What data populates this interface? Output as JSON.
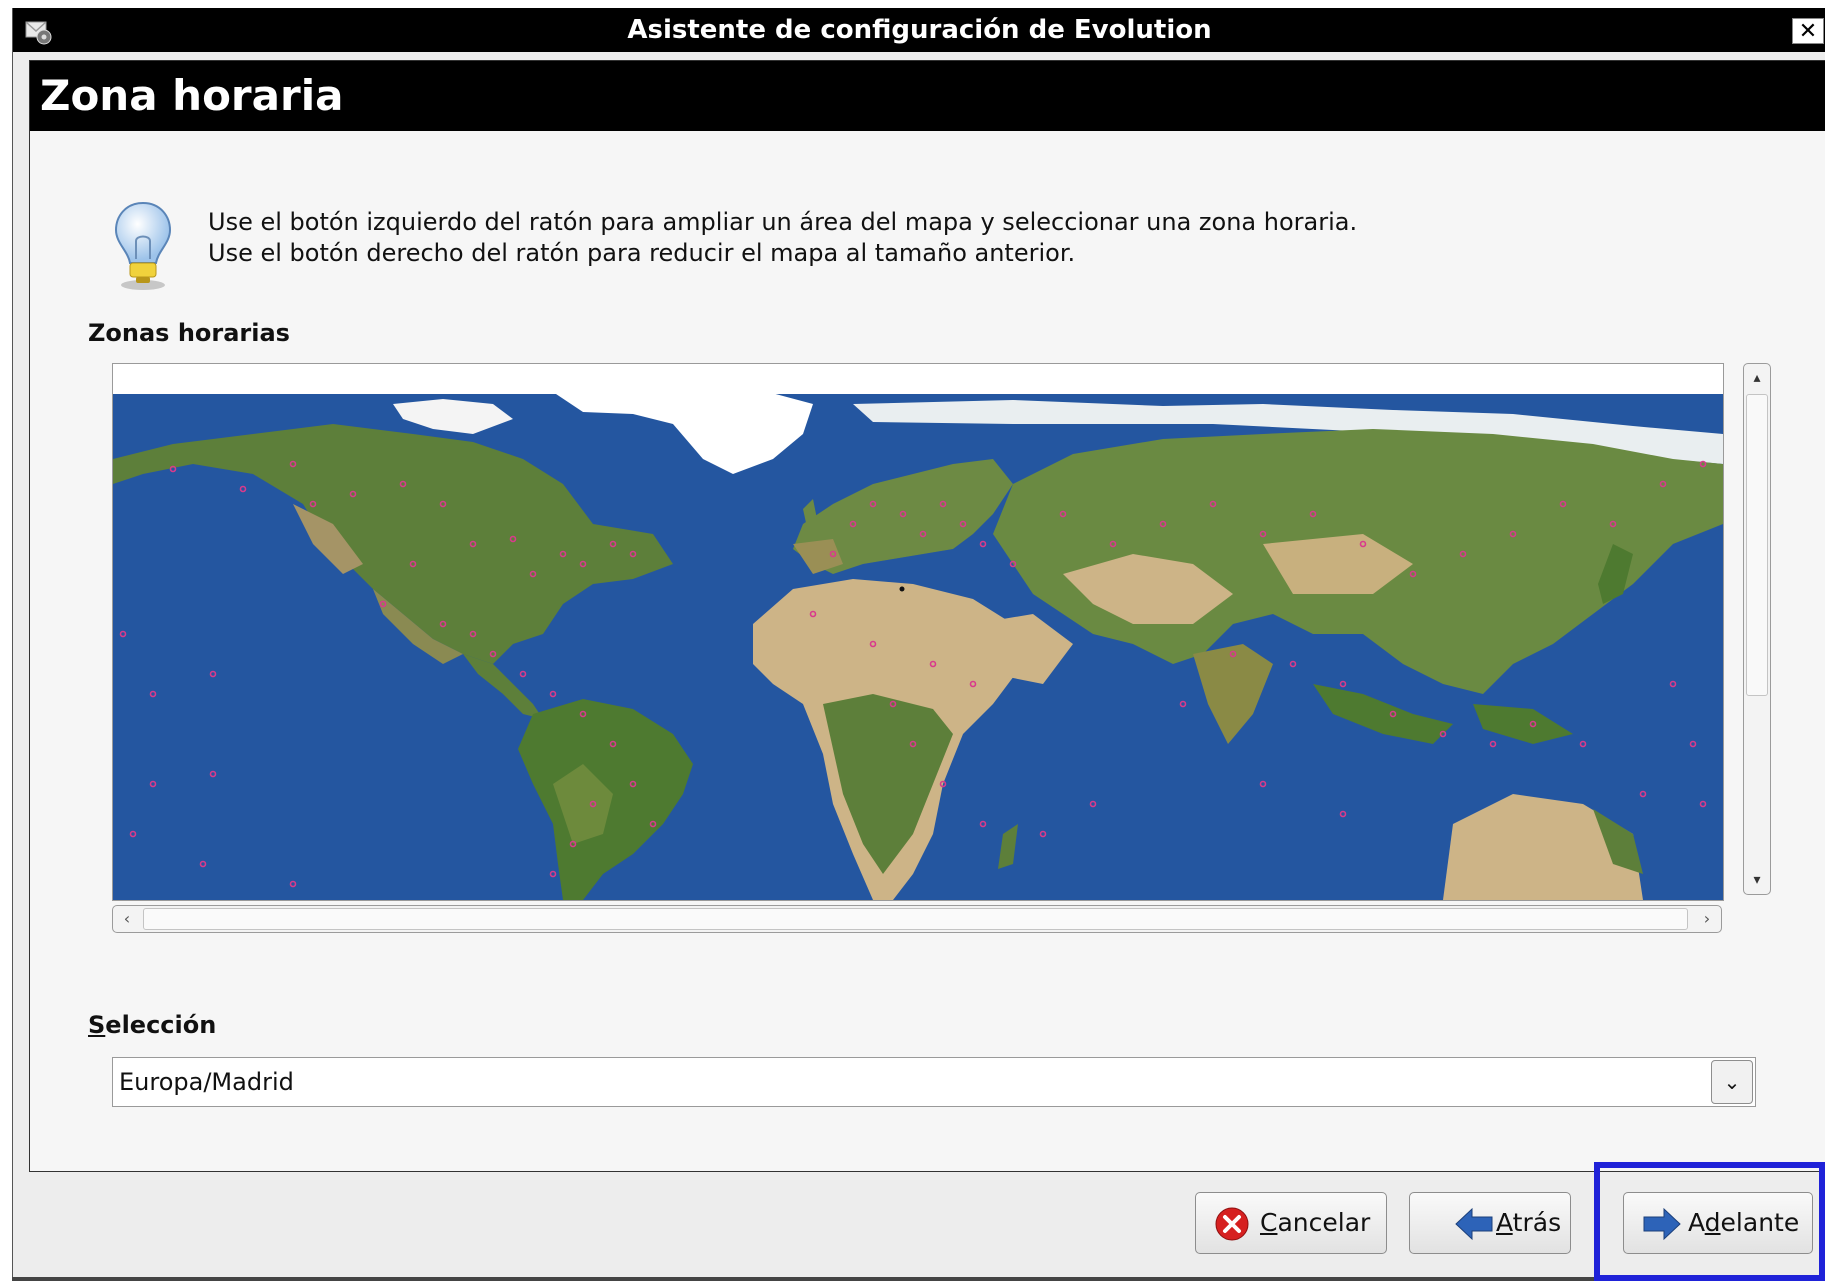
{
  "window": {
    "title": "Asistente de configuración de Evolution",
    "close_label": "✕",
    "app_icon": "evolution-mail-settings-icon"
  },
  "page": {
    "heading": "Zona horaria",
    "hint_line1": "Use el botón izquierdo del ratón para ampliar un área del mapa y seleccionar una zona horaria.",
    "hint_line2": "Use el botón derecho del ratón para reducir el mapa al tamaño anterior.",
    "hint_icon": "lightbulb-icon"
  },
  "map": {
    "section_label": "Zonas horarias",
    "ocean_color": "#2456a0",
    "land_color": "#5d7f3a",
    "desert_color": "#cdb487",
    "ice_color": "#ffffff",
    "marker_color": "#d93a8c"
  },
  "selection": {
    "label_mnemonic": "S",
    "label_rest": "elección",
    "value": "Europa/Madrid"
  },
  "buttons": {
    "cancel_mnemonic": "C",
    "cancel_rest": "ancelar",
    "back_mnemonic": "A",
    "back_rest": "trás",
    "forward_prefix": "A",
    "forward_mnemonic": "d",
    "forward_rest": "elante"
  },
  "colors": {
    "titlebar": "#000000",
    "highlight": "#1f22d8",
    "cancel_icon": "#d62020",
    "arrow_icon": "#2d63b8"
  }
}
